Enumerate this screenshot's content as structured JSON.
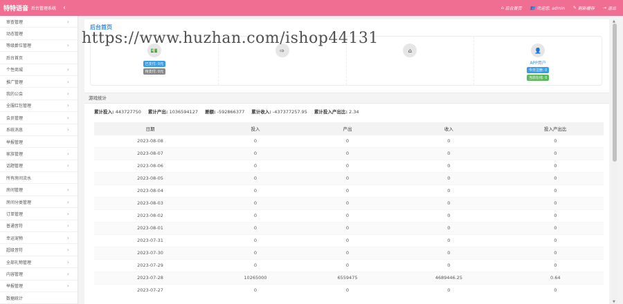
{
  "header": {
    "brand": "特特语音",
    "subtitle": "后台管理系统",
    "collapse_icon": "‹",
    "nav": [
      {
        "icon": "⌂",
        "label": "后台首页"
      },
      {
        "icon": "👥",
        "label": "欢迎您, admin"
      },
      {
        "icon": "✎",
        "label": "刷新缓存"
      },
      {
        "icon": "⇥",
        "label": "退出"
      }
    ]
  },
  "sidebar": {
    "items": [
      {
        "label": "审查管理",
        "arrow": "›"
      },
      {
        "label": "动态管理",
        "arrow": ""
      },
      {
        "label": "等级爵位管理",
        "arrow": "›"
      },
      {
        "label": "后台首页",
        "arrow": ""
      },
      {
        "label": "个性商城",
        "arrow": "›"
      },
      {
        "label": "推广管理",
        "arrow": "›"
      },
      {
        "label": "我的公会",
        "arrow": "›"
      },
      {
        "label": "全服红包管理",
        "arrow": "›"
      },
      {
        "label": "会员管理",
        "arrow": "›"
      },
      {
        "label": "系统消息",
        "arrow": "›"
      },
      {
        "label": "举报管理",
        "arrow": ""
      },
      {
        "label": "家族管理",
        "arrow": "›"
      },
      {
        "label": "话题管理",
        "arrow": "›"
      },
      {
        "label": "所有房间流水",
        "arrow": ""
      },
      {
        "label": "房间管理",
        "arrow": "›"
      },
      {
        "label": "房间分类管理",
        "arrow": "›"
      },
      {
        "label": "订单管理",
        "arrow": "›"
      },
      {
        "label": "普通音符",
        "arrow": "›"
      },
      {
        "label": "幸运宠物",
        "arrow": "›"
      },
      {
        "label": "超级音符",
        "arrow": "›"
      },
      {
        "label": "全部礼物管理",
        "arrow": "›"
      },
      {
        "label": "内容管理",
        "arrow": "›"
      },
      {
        "label": "举报管理",
        "arrow": "›"
      },
      {
        "label": "数据统计",
        "arrow": ""
      }
    ]
  },
  "main": {
    "title": "后台首页",
    "stats": [
      {
        "icon": "💵",
        "name": "",
        "badges": [
          {
            "text": "已支付: 0元",
            "color": "blue"
          },
          {
            "text": "待支付: 0元",
            "color": "gray"
          }
        ]
      },
      {
        "icon": "⇨",
        "name": "",
        "badges": []
      },
      {
        "icon": "⌂",
        "name": "",
        "badges": []
      },
      {
        "icon": "👤",
        "name": "APP用户",
        "badges": [
          {
            "text": "今日注册: 0",
            "color": "blue"
          },
          {
            "text": "当前在线: 0",
            "color": "green"
          }
        ]
      }
    ],
    "watermark": "https://www.huzhan.com/ishop44131",
    "section_title": "游戏统计",
    "summary": [
      {
        "label": "累计投入:",
        "value": "443727750"
      },
      {
        "label": "累计产出:",
        "value": "1036594127"
      },
      {
        "label": "差额:",
        "value": "-592866377"
      },
      {
        "label": "累计收入:",
        "value": "-437377257.95"
      },
      {
        "label": "累计投入产出比:",
        "value": "2.34"
      }
    ],
    "table": {
      "headers": [
        "日期",
        "投入",
        "产出",
        "收入",
        "投入产出比"
      ],
      "rows": [
        [
          "2023-08-08",
          "0",
          "0",
          "0",
          "0"
        ],
        [
          "2023-08-07",
          "0",
          "0",
          "0",
          "0"
        ],
        [
          "2023-08-06",
          "0",
          "0",
          "0",
          "0"
        ],
        [
          "2023-08-05",
          "0",
          "0",
          "0",
          "0"
        ],
        [
          "2023-08-04",
          "0",
          "0",
          "0",
          "0"
        ],
        [
          "2023-08-03",
          "0",
          "0",
          "0",
          "0"
        ],
        [
          "2023-08-02",
          "0",
          "0",
          "0",
          "0"
        ],
        [
          "2023-08-01",
          "0",
          "0",
          "0",
          "0"
        ],
        [
          "2023-07-31",
          "0",
          "0",
          "0",
          "0"
        ],
        [
          "2023-07-30",
          "0",
          "0",
          "0",
          "0"
        ],
        [
          "2023-07-29",
          "0",
          "0",
          "0",
          "0"
        ],
        [
          "2023-07-28",
          "10265000",
          "6559475",
          "4689446.25",
          "0.64"
        ],
        [
          "2023-07-27",
          "0",
          "0",
          "0",
          "0"
        ]
      ]
    }
  },
  "colors": {
    "topbar": "#f06e92",
    "accent": "#3a8ee6"
  }
}
